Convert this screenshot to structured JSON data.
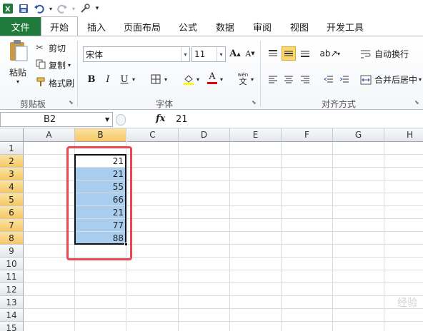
{
  "quick_access": {
    "excel_icon": "excel-icon",
    "save_icon": "save-icon",
    "undo_icon": "undo-icon",
    "redo_icon": "redo-icon",
    "customize_icon": "customize-icon"
  },
  "tabs": [
    {
      "label": "文件"
    },
    {
      "label": "开始"
    },
    {
      "label": "插入"
    },
    {
      "label": "页面布局"
    },
    {
      "label": "公式"
    },
    {
      "label": "数据"
    },
    {
      "label": "审阅"
    },
    {
      "label": "视图"
    },
    {
      "label": "开发工具"
    }
  ],
  "ribbon": {
    "clipboard": {
      "paste_label": "粘贴",
      "cut_label": "剪切",
      "copy_label": "复制",
      "format_painter_label": "格式刷",
      "group_label": "剪贴板"
    },
    "font": {
      "font_name": "宋体",
      "font_size": "11",
      "bold": "B",
      "italic": "I",
      "underline": "U",
      "group_label": "字体"
    },
    "alignment": {
      "wrap_text_label": "自动换行",
      "merge_center_label": "合并后居中",
      "group_label": "对齐方式"
    }
  },
  "formula_bar": {
    "name_box": "B2",
    "fx_label": "fx",
    "value": "21"
  },
  "sheet": {
    "columns": [
      "A",
      "B",
      "C",
      "D",
      "E",
      "F",
      "G",
      "H"
    ],
    "rows": [
      "1",
      "2",
      "3",
      "4",
      "5",
      "6",
      "7",
      "8",
      "9",
      "10",
      "11",
      "12",
      "13",
      "14",
      "15"
    ],
    "b_values": [
      "",
      "21",
      "21",
      "55",
      "66",
      "21",
      "77",
      "88",
      "",
      "",
      "",
      "",
      "",
      "",
      ""
    ]
  },
  "colors": {
    "file_tab": "#1f7a3c",
    "selection_fill": "#a9cdee",
    "annotation_red": "#e8484f",
    "header_highlight": "#f5c865"
  },
  "watermark": "经验"
}
